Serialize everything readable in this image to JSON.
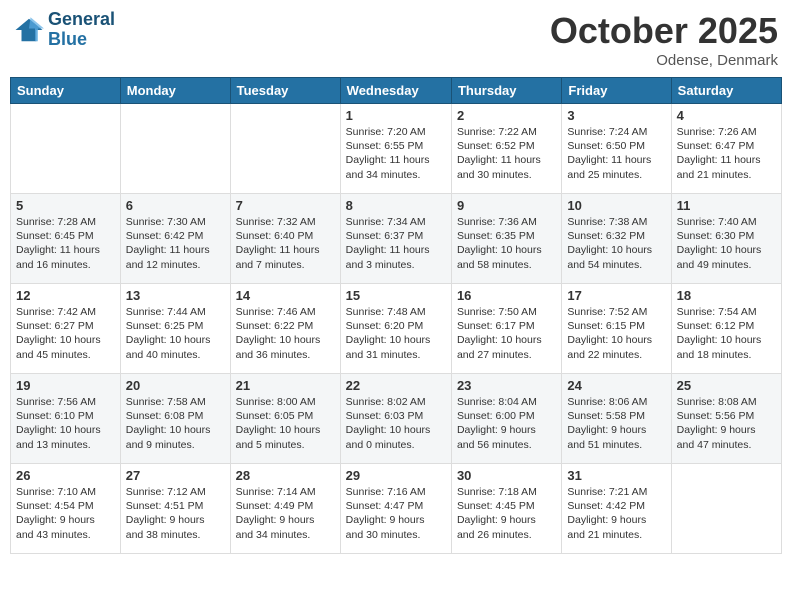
{
  "header": {
    "logo_line1": "General",
    "logo_line2": "Blue",
    "month": "October 2025",
    "location": "Odense, Denmark"
  },
  "days_of_week": [
    "Sunday",
    "Monday",
    "Tuesday",
    "Wednesday",
    "Thursday",
    "Friday",
    "Saturday"
  ],
  "weeks": [
    [
      {
        "day": "",
        "info": ""
      },
      {
        "day": "",
        "info": ""
      },
      {
        "day": "",
        "info": ""
      },
      {
        "day": "1",
        "info": "Sunrise: 7:20 AM\nSunset: 6:55 PM\nDaylight: 11 hours\nand 34 minutes."
      },
      {
        "day": "2",
        "info": "Sunrise: 7:22 AM\nSunset: 6:52 PM\nDaylight: 11 hours\nand 30 minutes."
      },
      {
        "day": "3",
        "info": "Sunrise: 7:24 AM\nSunset: 6:50 PM\nDaylight: 11 hours\nand 25 minutes."
      },
      {
        "day": "4",
        "info": "Sunrise: 7:26 AM\nSunset: 6:47 PM\nDaylight: 11 hours\nand 21 minutes."
      }
    ],
    [
      {
        "day": "5",
        "info": "Sunrise: 7:28 AM\nSunset: 6:45 PM\nDaylight: 11 hours\nand 16 minutes."
      },
      {
        "day": "6",
        "info": "Sunrise: 7:30 AM\nSunset: 6:42 PM\nDaylight: 11 hours\nand 12 minutes."
      },
      {
        "day": "7",
        "info": "Sunrise: 7:32 AM\nSunset: 6:40 PM\nDaylight: 11 hours\nand 7 minutes."
      },
      {
        "day": "8",
        "info": "Sunrise: 7:34 AM\nSunset: 6:37 PM\nDaylight: 11 hours\nand 3 minutes."
      },
      {
        "day": "9",
        "info": "Sunrise: 7:36 AM\nSunset: 6:35 PM\nDaylight: 10 hours\nand 58 minutes."
      },
      {
        "day": "10",
        "info": "Sunrise: 7:38 AM\nSunset: 6:32 PM\nDaylight: 10 hours\nand 54 minutes."
      },
      {
        "day": "11",
        "info": "Sunrise: 7:40 AM\nSunset: 6:30 PM\nDaylight: 10 hours\nand 49 minutes."
      }
    ],
    [
      {
        "day": "12",
        "info": "Sunrise: 7:42 AM\nSunset: 6:27 PM\nDaylight: 10 hours\nand 45 minutes."
      },
      {
        "day": "13",
        "info": "Sunrise: 7:44 AM\nSunset: 6:25 PM\nDaylight: 10 hours\nand 40 minutes."
      },
      {
        "day": "14",
        "info": "Sunrise: 7:46 AM\nSunset: 6:22 PM\nDaylight: 10 hours\nand 36 minutes."
      },
      {
        "day": "15",
        "info": "Sunrise: 7:48 AM\nSunset: 6:20 PM\nDaylight: 10 hours\nand 31 minutes."
      },
      {
        "day": "16",
        "info": "Sunrise: 7:50 AM\nSunset: 6:17 PM\nDaylight: 10 hours\nand 27 minutes."
      },
      {
        "day": "17",
        "info": "Sunrise: 7:52 AM\nSunset: 6:15 PM\nDaylight: 10 hours\nand 22 minutes."
      },
      {
        "day": "18",
        "info": "Sunrise: 7:54 AM\nSunset: 6:12 PM\nDaylight: 10 hours\nand 18 minutes."
      }
    ],
    [
      {
        "day": "19",
        "info": "Sunrise: 7:56 AM\nSunset: 6:10 PM\nDaylight: 10 hours\nand 13 minutes."
      },
      {
        "day": "20",
        "info": "Sunrise: 7:58 AM\nSunset: 6:08 PM\nDaylight: 10 hours\nand 9 minutes."
      },
      {
        "day": "21",
        "info": "Sunrise: 8:00 AM\nSunset: 6:05 PM\nDaylight: 10 hours\nand 5 minutes."
      },
      {
        "day": "22",
        "info": "Sunrise: 8:02 AM\nSunset: 6:03 PM\nDaylight: 10 hours\nand 0 minutes."
      },
      {
        "day": "23",
        "info": "Sunrise: 8:04 AM\nSunset: 6:00 PM\nDaylight: 9 hours\nand 56 minutes."
      },
      {
        "day": "24",
        "info": "Sunrise: 8:06 AM\nSunset: 5:58 PM\nDaylight: 9 hours\nand 51 minutes."
      },
      {
        "day": "25",
        "info": "Sunrise: 8:08 AM\nSunset: 5:56 PM\nDaylight: 9 hours\nand 47 minutes."
      }
    ],
    [
      {
        "day": "26",
        "info": "Sunrise: 7:10 AM\nSunset: 4:54 PM\nDaylight: 9 hours\nand 43 minutes."
      },
      {
        "day": "27",
        "info": "Sunrise: 7:12 AM\nSunset: 4:51 PM\nDaylight: 9 hours\nand 38 minutes."
      },
      {
        "day": "28",
        "info": "Sunrise: 7:14 AM\nSunset: 4:49 PM\nDaylight: 9 hours\nand 34 minutes."
      },
      {
        "day": "29",
        "info": "Sunrise: 7:16 AM\nSunset: 4:47 PM\nDaylight: 9 hours\nand 30 minutes."
      },
      {
        "day": "30",
        "info": "Sunrise: 7:18 AM\nSunset: 4:45 PM\nDaylight: 9 hours\nand 26 minutes."
      },
      {
        "day": "31",
        "info": "Sunrise: 7:21 AM\nSunset: 4:42 PM\nDaylight: 9 hours\nand 21 minutes."
      },
      {
        "day": "",
        "info": ""
      }
    ]
  ]
}
